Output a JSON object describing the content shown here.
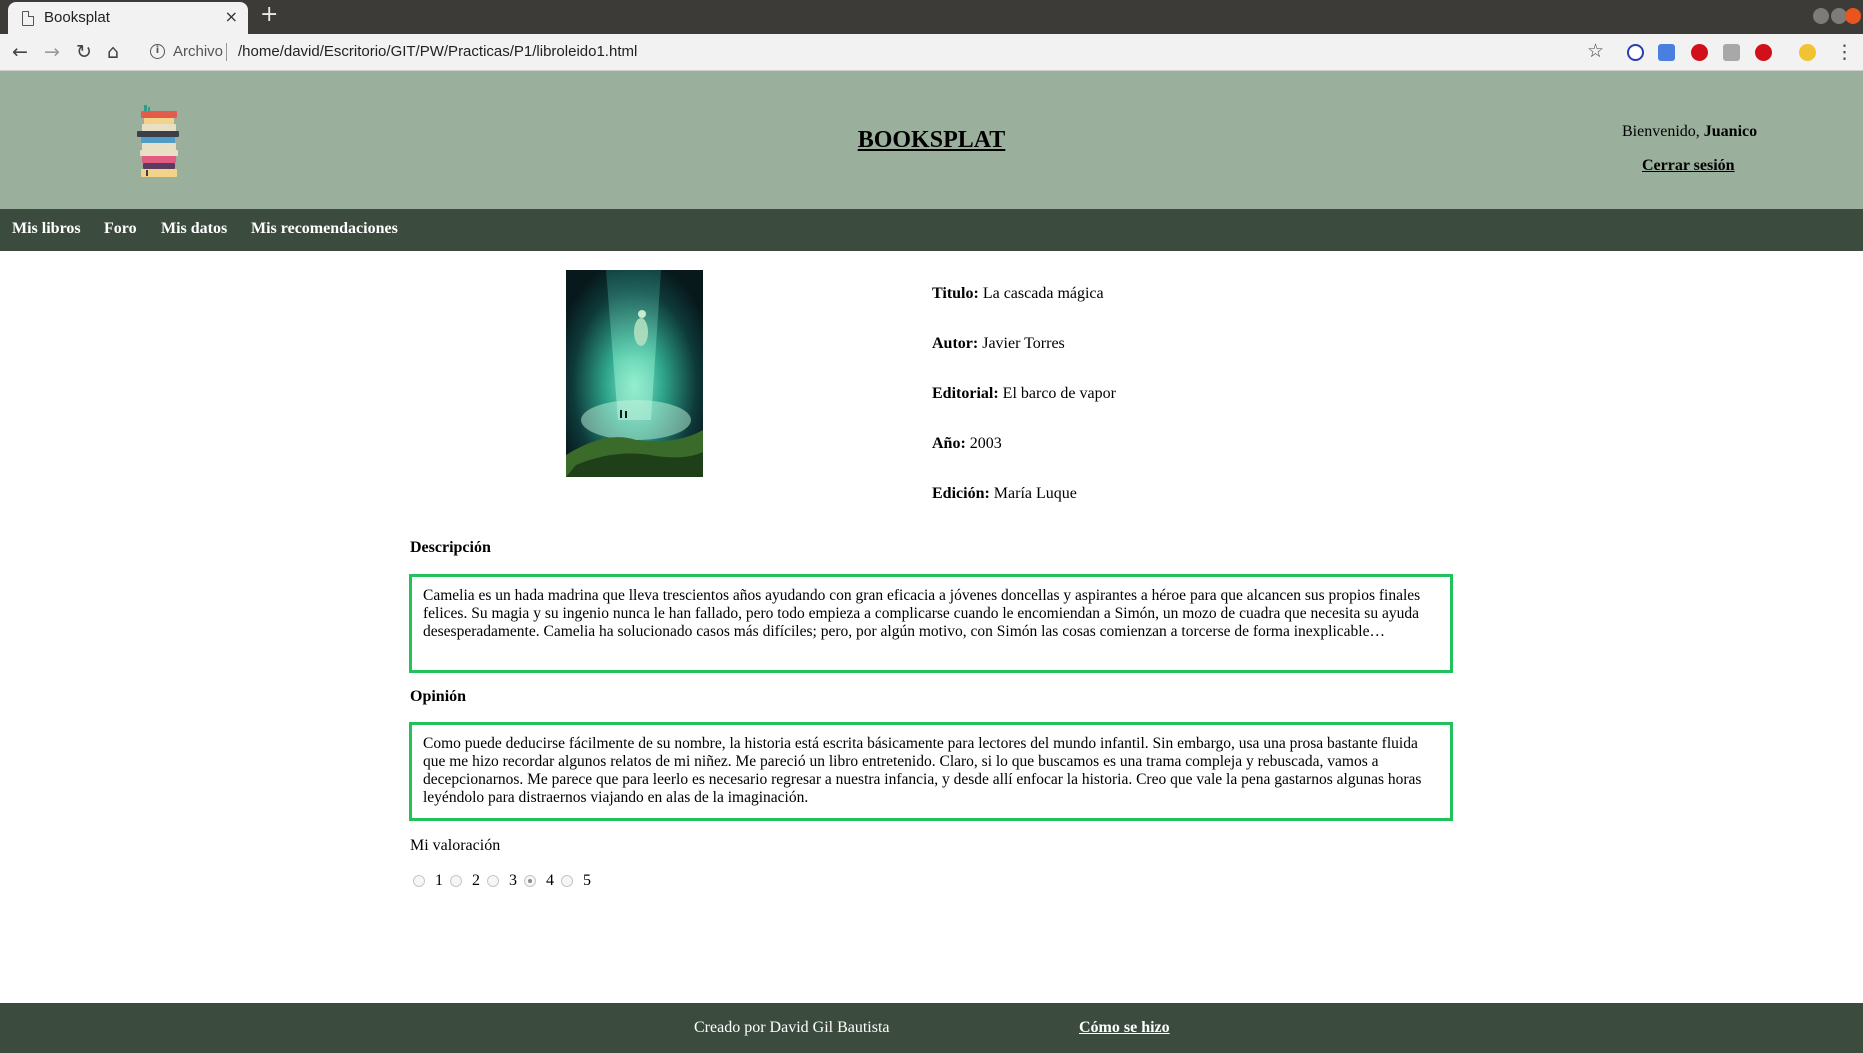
{
  "browser": {
    "tab_title": "Booksplat",
    "tab_close": "×",
    "new_tab": "+",
    "security_label": "Archivo",
    "url": "/home/david/Escritorio/GIT/PW/Practicas/P1/libroleido1.html",
    "icons": [
      "back-icon",
      "forward-icon",
      "reload-icon",
      "home-icon",
      "info-icon",
      "star-icon",
      "block-icon",
      "translate-icon",
      "ublock-icon",
      "extension-icon",
      "yab-icon",
      "emoji-icon",
      "menu-icon"
    ]
  },
  "header": {
    "title": "BOOKSPLAT",
    "welcome_text": "Bienvenido, ",
    "user_name": "Juanico",
    "logout_label": "Cerrar sesión"
  },
  "nav": {
    "items": [
      {
        "label": "Mis libros"
      },
      {
        "label": "Foro"
      },
      {
        "label": "Mis datos"
      },
      {
        "label": "Mis recomendaciones"
      }
    ]
  },
  "book": {
    "fields": [
      {
        "label": "Titulo:",
        "value": "La cascada mágica"
      },
      {
        "label": "Autor:",
        "value": "Javier Torres"
      },
      {
        "label": "Editorial:",
        "value": "El barco de vapor"
      },
      {
        "label": "Año:",
        "value": "2003"
      },
      {
        "label": "Edición:",
        "value": "María Luque"
      }
    ],
    "description_title": "Descripción",
    "description": "Camelia es un hada madrina que lleva trescientos años ayudando con gran eficacia a jóvenes doncellas y aspirantes a héroe para que alcancen sus propios finales felices. Su magia y su ingenio nunca le han fallado, pero todo empieza a complicarse cuando le encomiendan a Simón, un mozo de cuadra que necesita su ayuda desesperadamente. Camelia ha solucionado casos más difíciles; pero, por algún motivo, con Simón las cosas comienzan a torcerse de forma inexplicable…",
    "opinion_title": "Opinión",
    "opinion": "Como puede deducirse fácilmente de su nombre, la historia está escrita básicamente para lectores del mundo infantil. Sin embargo, usa una prosa bastante fluida que me hizo recordar algunos relatos de mi niñez. Me pareció un libro entretenido. Claro, si lo que buscamos es una trama compleja y rebuscada, vamos a decepcionarnos. Me parece que para leerlo es necesario regresar a nuestra infancia, y desde allí enfocar la historia. Creo que vale la pena gastarnos algunas horas leyéndolo para distraernos viajando en alas de la imaginación."
  },
  "rating": {
    "label": "Mi valoración",
    "options": [
      "1",
      "2",
      "3",
      "4",
      "5"
    ],
    "selected": "4"
  },
  "footer": {
    "credit": "Creado por David Gil Bautista",
    "howto_label": "Cómo se hizo"
  },
  "colors": {
    "header_bg": "#9ab09c",
    "nav_bg": "#3b4c3f",
    "box_border": "#21c25a"
  }
}
